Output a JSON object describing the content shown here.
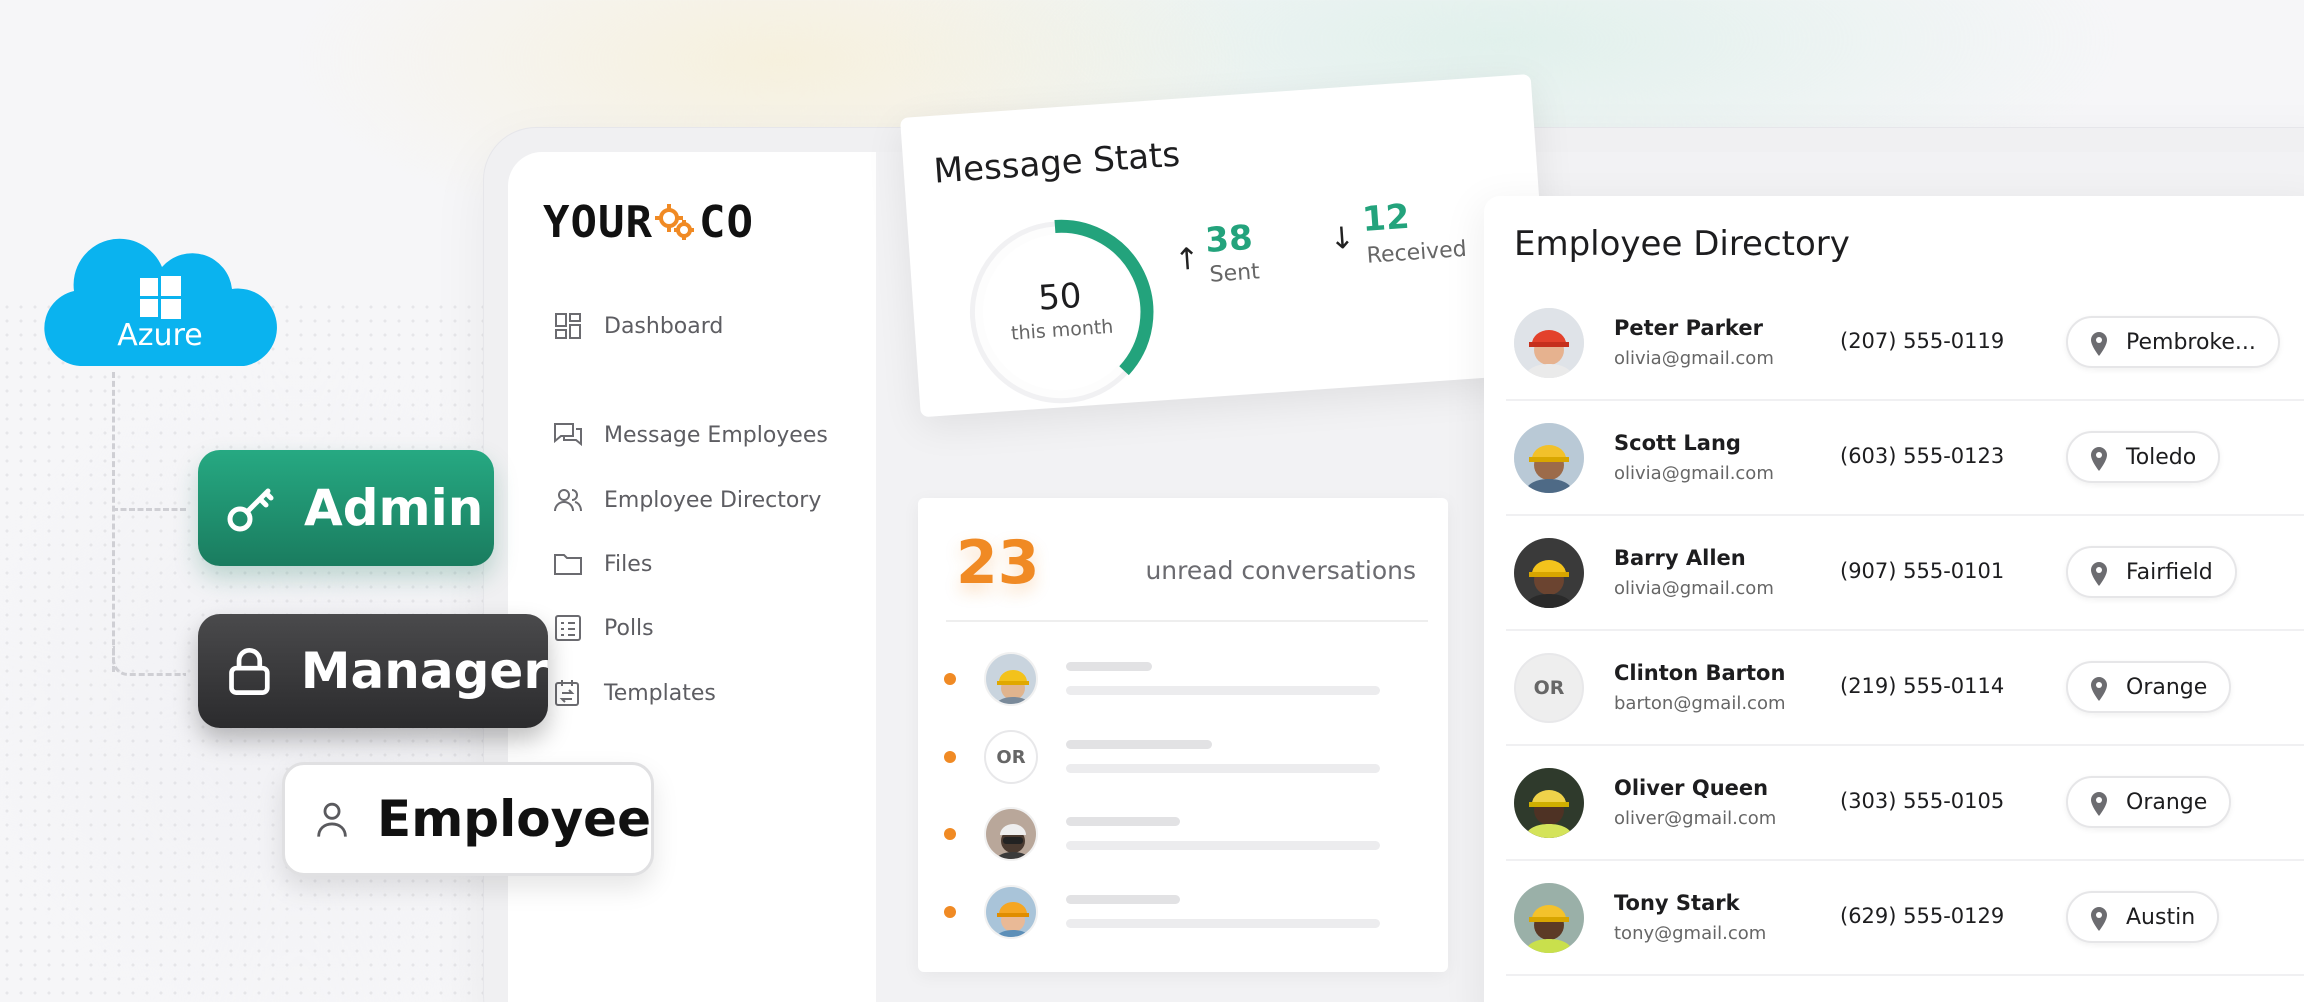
{
  "azure": {
    "label": "Azure",
    "brand_color": "#0ab3ef"
  },
  "roles": {
    "admin": {
      "label": "Admin",
      "icon": "key-icon",
      "color": "#1f9473"
    },
    "manager": {
      "label": "Manager",
      "icon": "lock-icon",
      "color": "#333335"
    },
    "employee": {
      "label": "Employee",
      "icon": "user-icon",
      "color": "#ffffff"
    }
  },
  "app": {
    "logo_left": "YOUR",
    "logo_right": "CO",
    "logo_accent": "#f08a24"
  },
  "sidebar": {
    "items": [
      {
        "label": "Dashboard",
        "icon": "dashboard-icon"
      },
      {
        "label": "Message Employees",
        "icon": "chat-icon"
      },
      {
        "label": "Employee Directory",
        "icon": "users-icon"
      },
      {
        "label": "Files",
        "icon": "folder-icon"
      },
      {
        "label": "Polls",
        "icon": "poll-icon"
      },
      {
        "label": "Templates",
        "icon": "template-icon"
      }
    ]
  },
  "message_stats": {
    "title": "Message Stats",
    "total": "50",
    "total_label": "this month",
    "sent": "38",
    "sent_label": "Sent",
    "received": "12",
    "received_label": "Received",
    "sent_fraction": 0.38,
    "accent": "#23a37c"
  },
  "unread": {
    "count": "23",
    "label": "unread conversations",
    "rows": [
      {
        "avatar": "worker-photo"
      },
      {
        "avatar_initials": "OR"
      },
      {
        "avatar": "worker-photo"
      },
      {
        "avatar": "worker-photo"
      }
    ]
  },
  "directory": {
    "title": "Employee Directory",
    "rows": [
      {
        "name": "Peter Parker",
        "email": "olivia@gmail.com",
        "phone": "(207) 555-0119",
        "location": "Pembroke..."
      },
      {
        "name": "Scott Lang",
        "email": "olivia@gmail.com",
        "phone": "(603) 555-0123",
        "location": "Toledo"
      },
      {
        "name": "Barry Allen",
        "email": "olivia@gmail.com",
        "phone": "(907) 555-0101",
        "location": "Fairfield"
      },
      {
        "name": "Clinton Barton",
        "email": "barton@gmail.com",
        "phone": "(219) 555-0114",
        "location": "Orange",
        "initials": "OR"
      },
      {
        "name": "Oliver Queen",
        "email": "oliver@gmail.com",
        "phone": "(303) 555-0105",
        "location": "Orange"
      },
      {
        "name": "Tony Stark",
        "email": "tony@gmail.com",
        "phone": "(629) 555-0129",
        "location": "Austin"
      }
    ]
  }
}
